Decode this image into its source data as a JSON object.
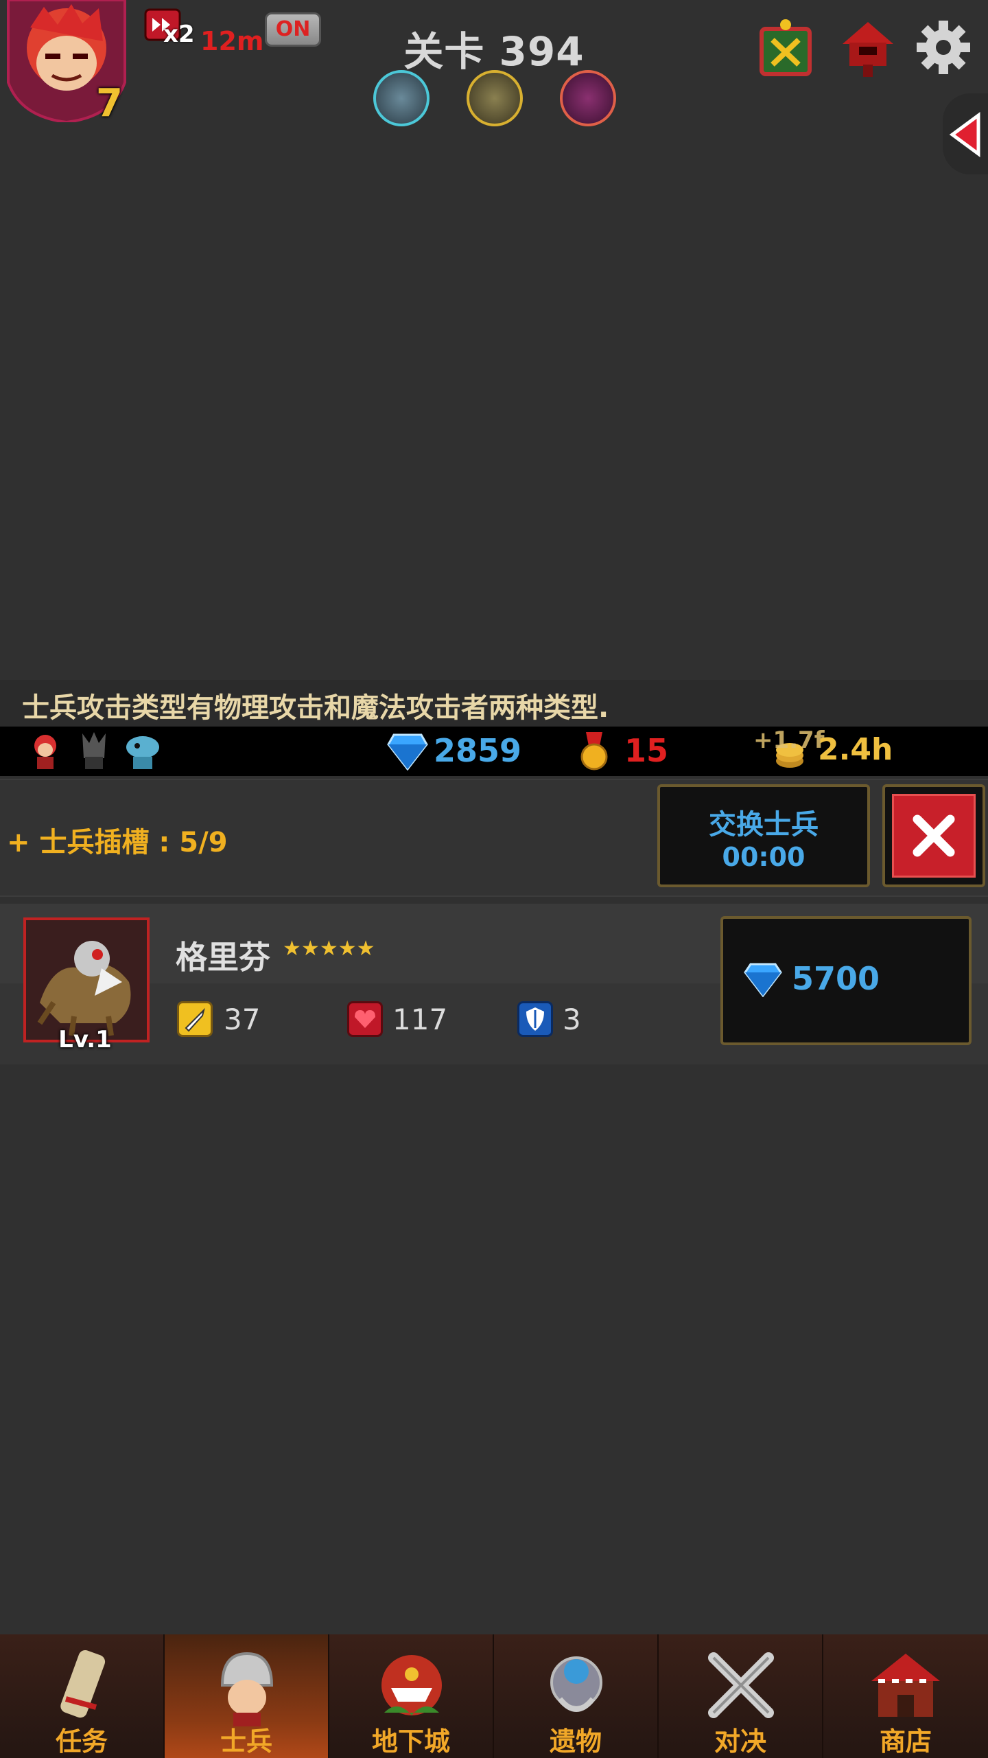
{
  "top": {
    "hero_level": "7",
    "speed_label": "x2",
    "timer": "12m",
    "toggle": "ON",
    "stage_title": "关卡 394"
  },
  "banner": {
    "message": "士兵攻击类型有物理攻击和魔法攻击者两种类型."
  },
  "resources": {
    "gems": "2859",
    "medals": "15",
    "bonus": "+1.7f",
    "time": "2.4h"
  },
  "slots": {
    "label": "+ 士兵插槽 : 5/9",
    "swap_label": "交换士兵",
    "swap_timer": "00:00"
  },
  "unit": {
    "name": "格里芬",
    "stars": 5,
    "level": "Lv.1",
    "attack": "37",
    "hp": "117",
    "defense": "3",
    "price": "5700"
  },
  "nav": [
    {
      "label": "任务",
      "icon": "scroll-icon",
      "active": false
    },
    {
      "label": "士兵",
      "icon": "helmet-soldier-icon",
      "active": true
    },
    {
      "label": "地下城",
      "icon": "monster-plant-icon",
      "active": false
    },
    {
      "label": "遗物",
      "icon": "orb-relic-icon",
      "active": false
    },
    {
      "label": "对决",
      "icon": "crossed-swords-icon",
      "active": false
    },
    {
      "label": "商店",
      "icon": "shop-icon",
      "active": false
    }
  ],
  "colors": {
    "gem_blue": "#49a9e8",
    "medal_red": "#e02020",
    "slot_gold": "#f0b020",
    "nav_gold": "#f2a828"
  }
}
